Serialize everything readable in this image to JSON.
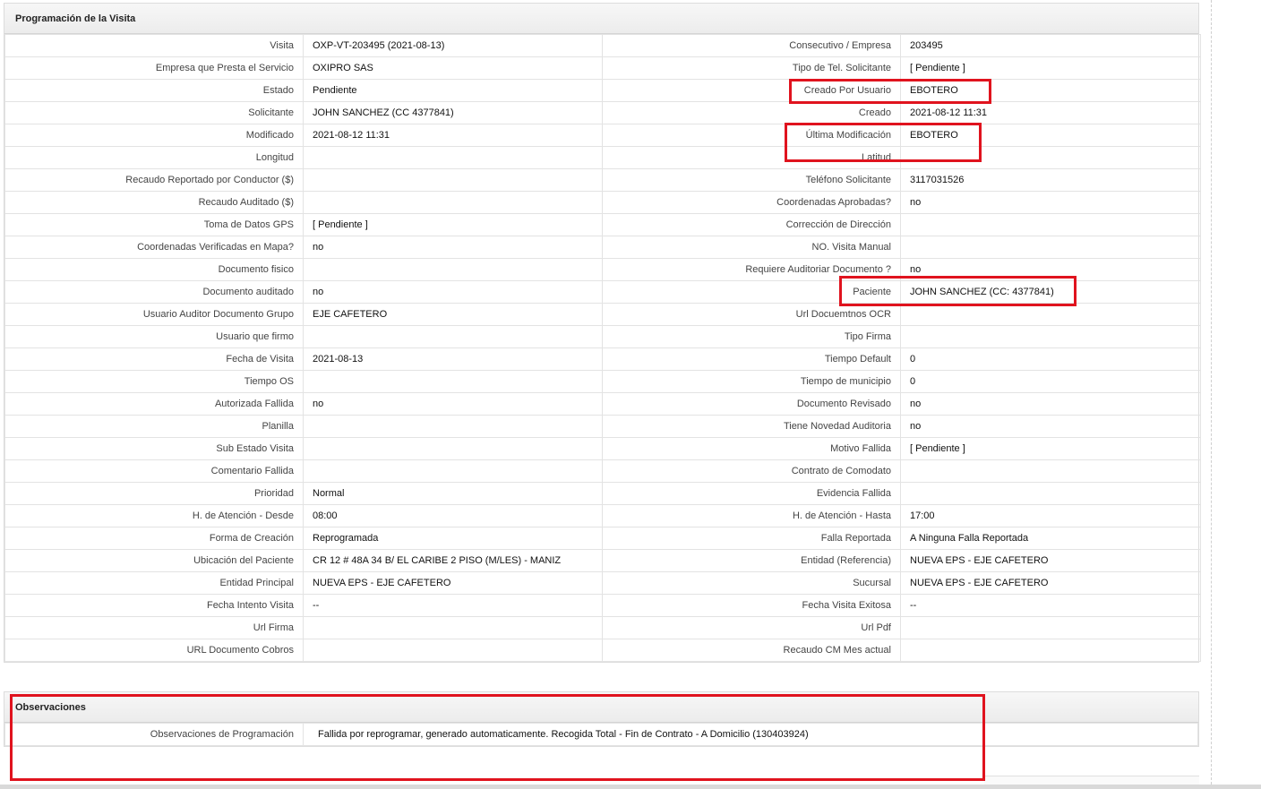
{
  "visit_section": {
    "title": "Programación de la Visita",
    "rows": [
      {
        "l1": "Visita",
        "v1": "OXP-VT-203495 (2021-08-13)",
        "l2": "Consecutivo / Empresa",
        "v2": "203495"
      },
      {
        "l1": "Empresa que Presta el Servicio",
        "v1": "OXIPRO SAS",
        "l2": "Tipo de Tel. Solicitante",
        "v2": "[ Pendiente ]"
      },
      {
        "l1": "Estado",
        "v1": "Pendiente",
        "l2": "Creado Por Usuario",
        "v2": "EBOTERO"
      },
      {
        "l1": "Solicitante",
        "v1": "JOHN SANCHEZ (CC 4377841)",
        "l2": "Creado",
        "v2": "2021-08-12 11:31"
      },
      {
        "l1": "Modificado",
        "v1": "2021-08-12 11:31",
        "l2": "Última Modificación",
        "v2": "EBOTERO"
      },
      {
        "l1": "Longitud",
        "v1": "",
        "l2": "Latitud",
        "v2": ""
      },
      {
        "l1": "Recaudo Reportado por Conductor ($)",
        "v1": "",
        "l2": "Teléfono Solicitante",
        "v2": "3117031526"
      },
      {
        "l1": "Recaudo Auditado ($)",
        "v1": "",
        "l2": "Coordenadas Aprobadas?",
        "v2": " no"
      },
      {
        "l1": "Toma de Datos GPS",
        "v1": "[ Pendiente ]",
        "l2": "Corrección de Dirección",
        "v2": ""
      },
      {
        "l1": "Coordenadas Verificadas en Mapa?",
        "v1": " no",
        "l2": "NO. Visita Manual",
        "v2": ""
      },
      {
        "l1": "Documento fisico",
        "v1": "",
        "l2": "Requiere Auditoriar Documento ?",
        "v2": " no"
      },
      {
        "l1": "Documento auditado",
        "v1": " no",
        "l2": "Paciente",
        "v2": "JOHN SANCHEZ (CC: 4377841)"
      },
      {
        "l1": "Usuario Auditor Documento Grupo",
        "v1": "EJE CAFETERO",
        "l2": "Url Docuemtnos OCR",
        "v2": ""
      },
      {
        "l1": "Usuario que firmo",
        "v1": "",
        "l2": "Tipo Firma",
        "v2": ""
      },
      {
        "l1": "Fecha de Visita",
        "v1": " 2021-08-13",
        "l2": "Tiempo Default",
        "v2": "0"
      },
      {
        "l1": "Tiempo OS",
        "v1": "",
        "l2": "Tiempo de municipio",
        "v2": "0"
      },
      {
        "l1": "Autorizada Fallida",
        "v1": " no",
        "l2": "Documento Revisado",
        "v2": " no"
      },
      {
        "l1": "Planilla",
        "v1": "",
        "l2": "Tiene Novedad Auditoria",
        "v2": " no"
      },
      {
        "l1": "Sub Estado Visita",
        "v1": "",
        "l2": "Motivo Fallida",
        "v2": "[ Pendiente ]"
      },
      {
        "l1": "Comentario Fallida",
        "v1": "",
        "l2": "Contrato de Comodato",
        "v2": ""
      },
      {
        "l1": "Prioridad",
        "v1": "Normal",
        "l2": "Evidencia Fallida",
        "v2": ""
      },
      {
        "l1": "H. de Atención - Desde",
        "v1": "08:00",
        "l2": "H. de Atención - Hasta",
        "v2": "17:00"
      },
      {
        "l1": "Forma de Creación",
        "v1": "Reprogramada",
        "l2": "Falla Reportada",
        "v2": "A Ninguna Falla Reportada"
      },
      {
        "l1": "Ubicación del Paciente",
        "v1": "CR 12 # 48A 34 B/ EL CARIBE 2 PISO (M/LES) - MANIZ",
        "l2": "Entidad (Referencia)",
        "v2": "NUEVA EPS - EJE CAFETERO"
      },
      {
        "l1": "Entidad Principal",
        "v1": "NUEVA EPS - EJE CAFETERO",
        "l2": "Sucursal",
        "v2": "NUEVA EPS - EJE CAFETERO"
      },
      {
        "l1": "Fecha Intento Visita",
        "v1": " --",
        "l2": "Fecha Visita Exitosa",
        "v2": " --"
      },
      {
        "l1": "Url Firma",
        "v1": "",
        "l2": "Url Pdf",
        "v2": ""
      },
      {
        "l1": "URL Documento Cobros",
        "v1": "",
        "l2": "Recaudo CM Mes actual",
        "v2": ""
      }
    ]
  },
  "observations_section": {
    "title": "Observaciones",
    "label": "Observaciones de Programación",
    "value": "Fallida por reprogramar, generado automaticamente. Recogida Total - Fin de Contrato - A Domicilio (130403924)"
  },
  "highlight_color": "#e0131e"
}
